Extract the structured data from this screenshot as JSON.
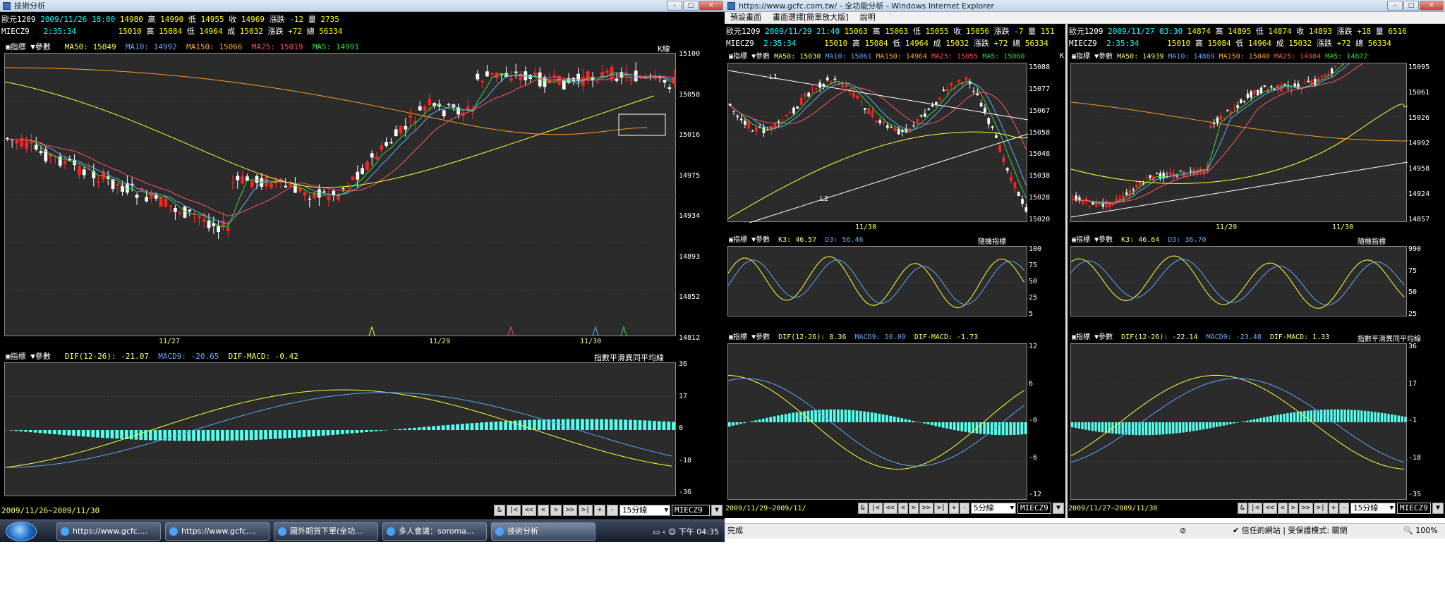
{
  "left": {
    "title": "技術分析",
    "hdr1": {
      "name": "歐元1209",
      "date": "2009/11/26 18:00",
      "h": "14980",
      "hl": "高",
      "hv": "14990",
      "ll": "低",
      "lv": "14955",
      "cl": "收",
      "cv": "14969",
      "zl": "漲跌",
      "zv": "-12",
      "vl": "量",
      "vv": "2735"
    },
    "hdr2": {
      "name": "MIECZ9",
      "time": "2:35:34",
      "o": "15010",
      "hl": "高",
      "hv": "15084",
      "ll": "低",
      "lv": "14964",
      "cl": "成",
      "cv": "15032",
      "zl": "漲跌",
      "zv": "+72",
      "tl": "總",
      "tv": "56334"
    },
    "price": {
      "ind": "▣指標",
      "par": "▼參數",
      "ma50": "MA50: 15049",
      "ma10": "MA10: 14992",
      "ma150": "MA150: 15066",
      "ma25": "MA25: 15019",
      "ma5": "MA5: 14991",
      "tag": "K線",
      "y": [
        "15100",
        "15058",
        "15016",
        "14975",
        "14934",
        "14893",
        "14852",
        "14812"
      ],
      "x": [
        "11/27",
        "11/29",
        "11/30"
      ]
    },
    "macd": {
      "ind": "▣指標",
      "par": "▼參數",
      "dif": "DIF(12-26): -21.07",
      "m9": "MACD9: -20.65",
      "dm": "DIF-MACD: -0.42",
      "tag": "指數平滑異同平均線",
      "y": [
        "36",
        "17",
        "0",
        "-18",
        "-36"
      ]
    },
    "range": "2009/11/26~2009/11/30",
    "period": "15分線",
    "sym": "MIECZ9"
  },
  "right": {
    "title": "https://www.gcfc.com.tw/ - 全功能分析 - Windows Internet Explorer",
    "menu": [
      "預設畫面",
      "畫面選擇[簡單放大版]",
      "說明"
    ],
    "status": "完成",
    "trust": "信任的網站 | 受保護模式: 關閉",
    "zoom": "100%",
    "c1": {
      "hdr1": {
        "name": "歐元1209",
        "date": "2009/11/29 21:40",
        "h": "15063",
        "hl": "高",
        "hv": "15063",
        "ll": "低",
        "lv": "15055",
        "cl": "收",
        "cv": "15056",
        "zl": "漲跌",
        "zv": "-7",
        "vl": "量",
        "vv": "151"
      },
      "hdr2": {
        "name": "MIECZ9",
        "time": "2:35:34",
        "o": "15010",
        "hl": "高",
        "hv": "15084",
        "ll": "低",
        "lv": "14964",
        "cl": "成",
        "cv": "15032",
        "zl": "漲跌",
        "zv": "+72",
        "tl": "總",
        "tv": "56334"
      },
      "price": {
        "ind": "▣指標",
        "par": "▼參數",
        "ma50": "MA50: 15030",
        "ma10": "MA10: 15061",
        "ma150": "MA150: 14964",
        "ma25": "MA25: 15055",
        "ma5": "MA5: 15060",
        "tag": "K",
        "y": [
          "15088",
          "15077",
          "15067",
          "15058",
          "15048",
          "15038",
          "15028",
          "15020"
        ],
        "x": [
          "11/30"
        ],
        "l1": "L1",
        "l2": "L2"
      },
      "kd": {
        "ind": "▣指標",
        "par": "▼參數",
        "k": "K3: 46.57",
        "d": "D3: 56.46",
        "tag": "隨機指標",
        "y": [
          "100",
          "75",
          "50",
          "25",
          "5"
        ]
      },
      "macd": {
        "ind": "▣指標",
        "par": "▼參數",
        "dif": "DIF(12-26): 8.36",
        "m9": "MACD9: 10.09",
        "dm": "DIF-MACD: -1.73",
        "y": [
          "12",
          "6",
          "-0",
          "-6",
          "-12"
        ]
      },
      "range": "2009/11/29~2009/11/",
      "period": "5分線",
      "sym": "MIECZ9"
    },
    "c2": {
      "hdr1": {
        "name": "歐元1209",
        "date": "2009/11/27 03:30",
        "h": "14874",
        "hl": "高",
        "hv": "14895",
        "ll": "低",
        "lv": "14874",
        "cl": "收",
        "cv": "14893",
        "zl": "漲跌",
        "zv": "+18",
        "vl": "量",
        "vv": "6516"
      },
      "hdr2": {
        "name": "MIECZ9",
        "time": "2:35:34",
        "o": "15010",
        "hl": "高",
        "hv": "15084",
        "ll": "低",
        "lv": "14964",
        "cl": "成",
        "cv": "15032",
        "zl": "漲跌",
        "zv": "+72",
        "tl": "總",
        "tv": "56334"
      },
      "price": {
        "ind": "▣指標",
        "par": "▼參數",
        "ma50": "MA50: 14939",
        "ma10": "MA10: 14869",
        "ma150": "MA150: 15040",
        "ma25": "MA25: 14904",
        "ma5": "MA5: 14872",
        "y": [
          "15095",
          "15061",
          "15026",
          "14992",
          "14958",
          "14924",
          "14857"
        ],
        "x": [
          "11/29",
          "11/30"
        ]
      },
      "kd": {
        "ind": "▣指標",
        "par": "▼參數",
        "k": "K3: 46.64",
        "d": "D3: 36.70",
        "tag": "隨機指標",
        "y": [
          "990",
          "75",
          "50",
          "25"
        ]
      },
      "macd": {
        "ind": "▣指標",
        "par": "▼參數",
        "dif": "DIF(12-26): -22.14",
        "m9": "MACD9: -23.48",
        "dm": "DIF-MACD: 1.33",
        "tag": "指數平滑異同平均線",
        "y": [
          "36",
          "17",
          "-1",
          "-18",
          "-35"
        ]
      },
      "range": "2009/11/27~2009/11/30",
      "period": "15分線",
      "sym": "MIECZ9"
    }
  },
  "nav": [
    "&",
    "|<",
    "<<",
    "<",
    ">",
    ">>",
    ">|",
    "+",
    "-"
  ],
  "taskbar": {
    "items": [
      "https://www.gcfc....",
      "https://www.gcfc....",
      "國外期貨下單(全功...",
      "多人會議：soroma...",
      "技術分析"
    ],
    "clock": "下午 04:35"
  }
}
